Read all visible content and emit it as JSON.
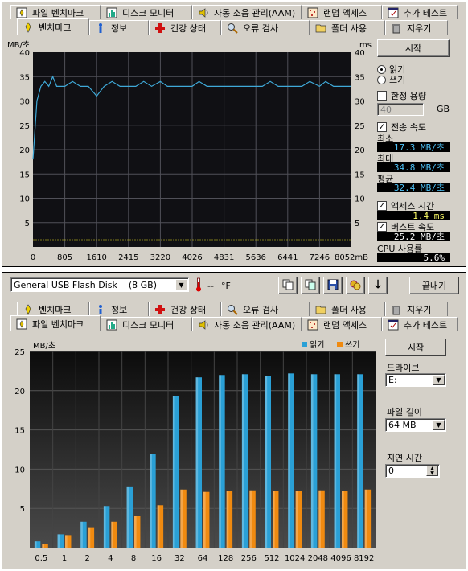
{
  "top_window": {
    "tabs_row1": [
      {
        "label": "파일 벤치마크",
        "icon": "file-benchmark-icon"
      },
      {
        "label": "디스크 모니터",
        "icon": "disk-monitor-icon"
      },
      {
        "label": "자동 소음 관리(AAM)",
        "icon": "speaker-icon"
      },
      {
        "label": "랜덤 액세스",
        "icon": "random-access-icon"
      },
      {
        "label": "추가 테스트",
        "icon": "extra-tests-icon"
      }
    ],
    "tabs_row2": [
      {
        "label": "벤치마크",
        "icon": "benchmark-icon",
        "active": true
      },
      {
        "label": "정보",
        "icon": "info-icon"
      },
      {
        "label": "건강 상태",
        "icon": "health-cross-icon"
      },
      {
        "label": "오류 검사",
        "icon": "magnifier-icon"
      },
      {
        "label": "폴더 사용",
        "icon": "folder-icon"
      },
      {
        "label": "지우기",
        "icon": "trash-icon"
      }
    ],
    "chart": {
      "y_unit_left": "MB/초",
      "y_unit_right": "ms",
      "y_ticks_left": [
        "40",
        "35",
        "30",
        "25",
        "20",
        "15",
        "10",
        "5"
      ],
      "y_ticks_right": [
        "40",
        "35",
        "30",
        "25",
        "20",
        "15",
        "10",
        "5"
      ],
      "x_ticks": [
        "0",
        "805",
        "1610",
        "2415",
        "3220",
        "4026",
        "4831",
        "5636",
        "6441",
        "7246",
        "8052mB"
      ]
    },
    "chart_data": {
      "type": "line",
      "title": "",
      "xlabel": "",
      "ylabel": "MB/초",
      "xlim": [
        0,
        8052
      ],
      "ylim": [
        0,
        40
      ],
      "grid": true,
      "series": [
        {
          "name": "",
          "color": "#3fa9d8",
          "x": [
            0,
            50,
            100,
            200,
            300,
            400,
            500,
            600,
            805,
            1000,
            1200,
            1400,
            1610,
            1800,
            2000,
            2200,
            2415,
            2600,
            2800,
            3000,
            3220,
            3400,
            3600,
            3800,
            4026,
            4200,
            4400,
            4600,
            4831,
            5000,
            5200,
            5400,
            5636,
            5800,
            6000,
            6200,
            6441,
            6600,
            6800,
            7000,
            7246,
            7400,
            7600,
            7800,
            8052
          ],
          "y": [
            18,
            24,
            30,
            33,
            34,
            33,
            35,
            33,
            33,
            34,
            33,
            33,
            31,
            33,
            34,
            33,
            33,
            33,
            34,
            33,
            34,
            33,
            33,
            33,
            33,
            34,
            33,
            33,
            33,
            33,
            33,
            33,
            33,
            33,
            34,
            33,
            33,
            33,
            33,
            34,
            33,
            34,
            33,
            33,
            33
          ]
        },
        {
          "name": "",
          "color": "#e8e020",
          "x": [
            0,
            805,
            1610,
            2415,
            3220,
            4026,
            4831,
            5636,
            6441,
            7246,
            8052
          ],
          "y": [
            1.4,
            1.4,
            1.4,
            1.4,
            1.4,
            1.4,
            1.4,
            1.4,
            1.4,
            1.4,
            1.4
          ]
        }
      ]
    },
    "side": {
      "start_button": "시작",
      "read_label": "읽기",
      "write_label": "쓰기",
      "limit_label": "한정 용량",
      "limit_value": "40",
      "limit_unit": "GB",
      "transfer_label": "전송 속도",
      "min_label": "최소",
      "min_value": "17.3 MB/초",
      "max_label": "최대",
      "max_value": "34.8 MB/초",
      "avg_label": "평균",
      "avg_value": "32.4 MB/초",
      "access_label": "액세스 시간",
      "access_value": "1.4 ms",
      "burst_label": "버스트 속도",
      "burst_value": "25.2 MB/초",
      "cpu_label": "CPU 사용률",
      "cpu_value": "5.6%"
    }
  },
  "bottom_window": {
    "toolbar": {
      "drive_select": "General USB Flash Disk    (8 GB)",
      "temp_value": "--",
      "temp_unit": "°F",
      "exit_button": "끝내기"
    },
    "tabs_row1": [
      {
        "label": "벤치마크",
        "icon": "benchmark-icon"
      },
      {
        "label": "정보",
        "icon": "info-icon"
      },
      {
        "label": "건강 상태",
        "icon": "health-cross-icon"
      },
      {
        "label": "오류 검사",
        "icon": "magnifier-icon"
      },
      {
        "label": "폴더 사용",
        "icon": "folder-icon"
      },
      {
        "label": "지우기",
        "icon": "trash-icon"
      }
    ],
    "tabs_row2": [
      {
        "label": "파일 벤치마크",
        "icon": "file-benchmark-icon",
        "active": true
      },
      {
        "label": "디스크 모니터",
        "icon": "disk-monitor-icon"
      },
      {
        "label": "자동 소음 관리(AAM)",
        "icon": "speaker-icon"
      },
      {
        "label": "랜덤 액세스",
        "icon": "random-access-icon"
      },
      {
        "label": "추가 테스트",
        "icon": "extra-tests-icon"
      }
    ],
    "chart": {
      "y_unit": "MB/초",
      "legend_read": "읽기",
      "legend_write": "쓰기",
      "y_ticks": [
        "25",
        "20",
        "15",
        "10",
        "5"
      ]
    },
    "chart_data": {
      "type": "bar",
      "title": "",
      "xlabel": "",
      "ylabel": "MB/초",
      "ylim": [
        0,
        25
      ],
      "legend": "top-right",
      "categories": [
        "0.5",
        "1",
        "2",
        "4",
        "8",
        "16",
        "32",
        "64",
        "128",
        "256",
        "512",
        "1024",
        "2048",
        "4096",
        "8192"
      ],
      "series": [
        {
          "name": "읽기",
          "color": "#2aa0d6",
          "values": [
            0.8,
            1.7,
            3.3,
            5.3,
            7.8,
            11.9,
            19.3,
            21.7,
            22.0,
            22.1,
            21.9,
            22.2,
            22.1,
            22.1,
            22.1
          ]
        },
        {
          "name": "쓰기",
          "color": "#f08a10",
          "values": [
            0.5,
            1.6,
            2.6,
            3.3,
            4.0,
            5.4,
            7.4,
            7.1,
            7.2,
            7.3,
            7.2,
            7.2,
            7.3,
            7.2,
            7.4
          ]
        }
      ]
    },
    "side": {
      "start_button": "시작",
      "drive_label": "드라이브",
      "drive_value": "E:",
      "file_length_label": "파일 길이",
      "file_length_value": "64 MB",
      "delay_label": "지연 시간",
      "delay_value": "0"
    }
  }
}
